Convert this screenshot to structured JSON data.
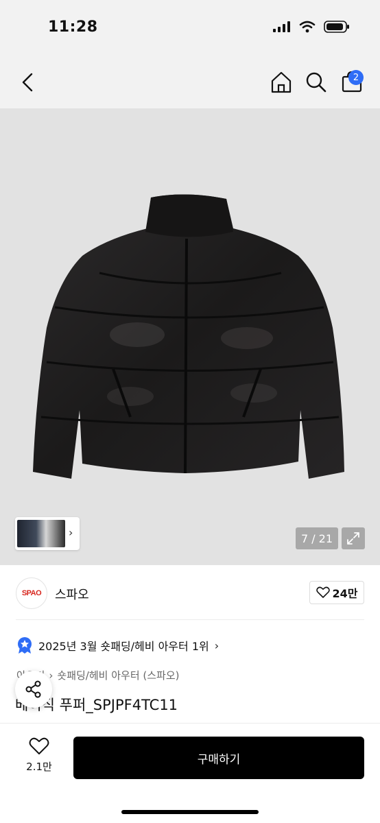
{
  "status_bar": {
    "time": "11:28"
  },
  "nav": {
    "cart_count": "2"
  },
  "gallery": {
    "counter": "7 / 21"
  },
  "brand": {
    "logo_text": "SPAO",
    "name": "스파오",
    "likes": "24만"
  },
  "ranking": {
    "text": "2025년 3월 숏패딩/헤비 아우터 1위"
  },
  "breadcrumb": {
    "parent": "아우터",
    "category": "숏패딩/헤비 아우터 (스파오)"
  },
  "product": {
    "name": "베이직 푸퍼_SPJPF4TC11"
  },
  "bottom_bar": {
    "wish_count": "2.1만",
    "buy_label": "구매하기"
  },
  "colors": {
    "accent_blue": "#2f6df6",
    "brand_red": "#d7261e",
    "buy_button": "#000000"
  }
}
